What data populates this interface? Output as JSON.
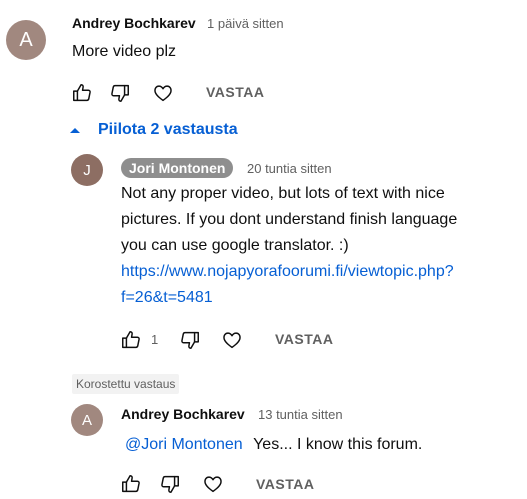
{
  "comment": {
    "avatar_letter": "A",
    "avatar_color": "#a1887f",
    "author": "Andrey Bochkarev",
    "time": "1 päivä sitten",
    "text": "More video plz",
    "reply_label": "VASTAA"
  },
  "replies_toggle": {
    "label": "Piilota 2 vastausta",
    "icon": "caret-up-icon"
  },
  "reply1": {
    "avatar_letter": "J",
    "avatar_color": "#8d6e63",
    "author": "Jori Montonen",
    "time": "20 tuntia sitten",
    "text_line1": "Not any proper video, but lots of text with nice",
    "text_line2": "pictures. If you dont understand finish language",
    "text_line3": "you can use google translator. :)",
    "link_line1": "https://www.nojapyorafoorumi.fi/viewtopic.php?",
    "link_line2": "f=26&t=5481",
    "like_count": "1",
    "reply_label": "VASTAA"
  },
  "highlighted_label": "Korostettu vastaus",
  "reply2": {
    "avatar_letter": "A",
    "avatar_color": "#a1887f",
    "author": "Andrey Bochkarev",
    "time": "13 tuntia sitten",
    "mention": "@Jori Montonen",
    "text": "Yes... I know this forum.",
    "reply_label": "VASTAA"
  },
  "icons": {
    "like": "thumbs-up-icon",
    "dislike": "thumbs-down-icon",
    "heart": "heart-icon"
  },
  "colors": {
    "link": "#065fd4",
    "secondary_text": "#606060"
  }
}
